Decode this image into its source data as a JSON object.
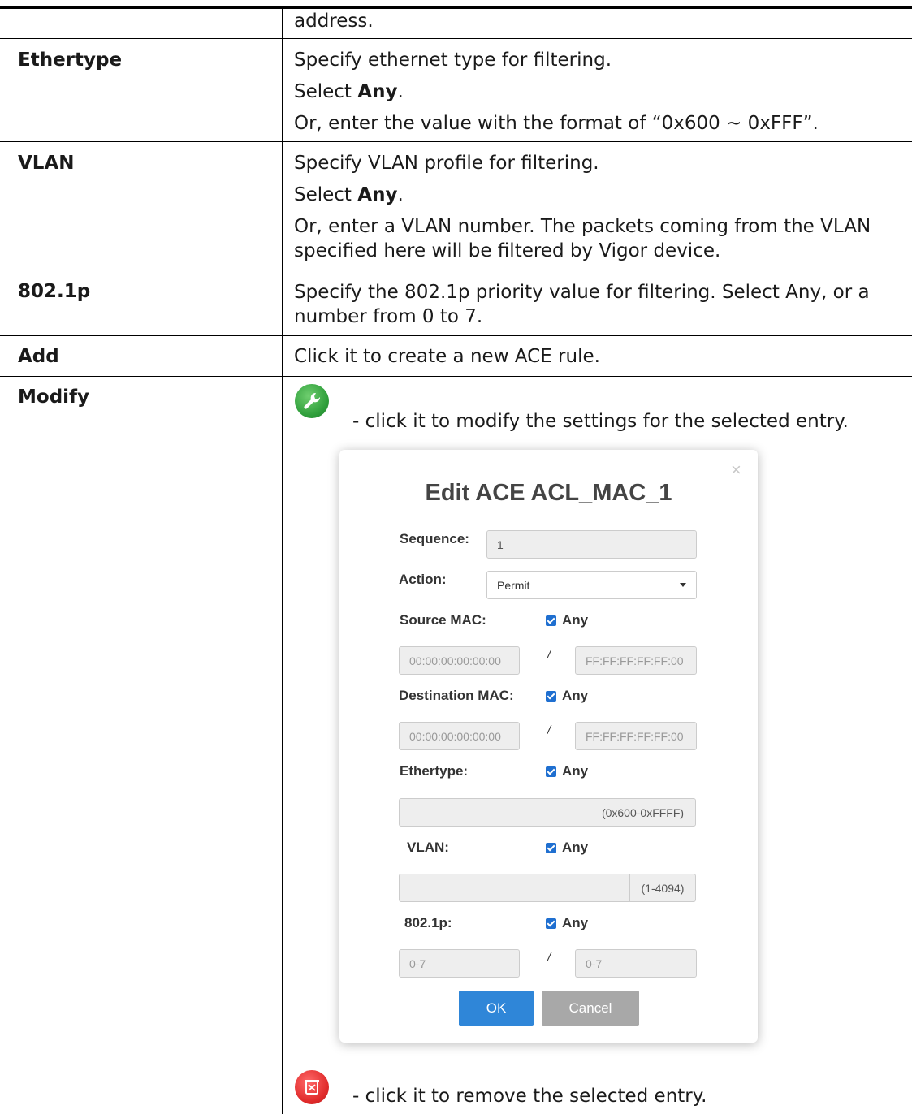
{
  "rows": [
    {
      "term": "",
      "desc": "address."
    },
    {
      "term": "Ethertype",
      "desc_lines": [
        "Specify ethernet type for filtering.",
        "Or, enter the value with the format of “0x600 ~ 0xFFF”."
      ],
      "select_prefix": "Select ",
      "select_bold": "Any",
      "select_suffix": "."
    },
    {
      "term": "VLAN",
      "desc_lines": [
        "Specify VLAN profile for filtering.",
        "Or, enter a VLAN number. The packets coming from the VLAN specified here will be filtered by Vigor device."
      ],
      "select_prefix": "Select ",
      "select_bold": "Any",
      "select_suffix": "."
    },
    {
      "term": "802.1p",
      "desc": "Specify the 802.1p priority value for filtering. Select Any, or a number from 0 to 7."
    },
    {
      "term": "Add",
      "desc": "Click it to create a new ACE rule."
    },
    {
      "term": "Modify",
      "modify_text": "- click it to modify the settings for the selected entry.",
      "delete_text": "- click it to remove the selected entry."
    }
  ],
  "icons": {
    "modify": "wrench-icon",
    "delete": "trash-icon",
    "modify_color": "#2e9e3a",
    "delete_color": "#e02a2a"
  },
  "dialog": {
    "close": "×",
    "title": "Edit ACE ACL_MAC_1",
    "sequence_label": "Sequence:",
    "sequence_value": "1",
    "action_label": "Action:",
    "action_value": "Permit",
    "source_mac_label": "Source MAC:",
    "dest_mac_label": "Destination MAC:",
    "ethertype_label": "Ethertype:",
    "vlan_label": "VLAN:",
    "priority_label": "802.1p:",
    "any_label": "Any",
    "slash": "/",
    "mac_placeholder": "00:00:00:00:00:00",
    "mask_placeholder": "FF:FF:FF:FF:FF:00",
    "ethertype_range": "(0x600-0xFFFF)",
    "vlan_range": "(1-4094)",
    "priority_placeholder": "0-7",
    "ok": "OK",
    "cancel": "Cancel",
    "accent_color": "#2f86d8"
  }
}
